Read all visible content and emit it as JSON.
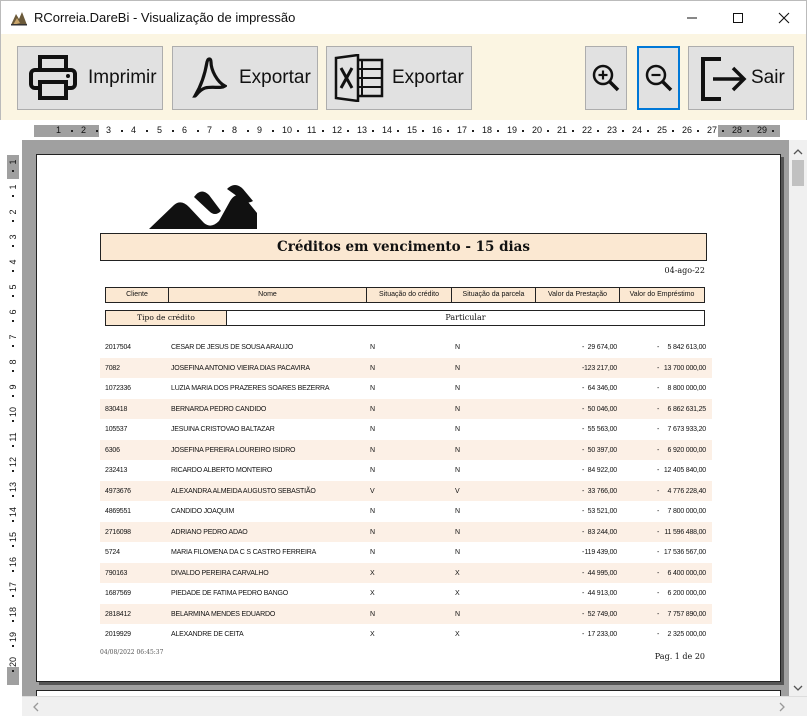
{
  "window": {
    "title": "RCorreia.DareBi - Visualização de impressão",
    "minimize_glyph": "—",
    "maximize_glyph": "☐",
    "close_glyph": "✕"
  },
  "toolbar": {
    "print_label": "Imprimir",
    "export_pdf_label": "Exportar",
    "export_excel_label": "Exportar",
    "exit_label": "Sair"
  },
  "ruler": {
    "h_marks": [
      "1",
      "1",
      "2",
      "3",
      "4",
      "5",
      "6",
      "7",
      "8",
      "9",
      "10",
      "11",
      "12",
      "13",
      "14",
      "15",
      "16",
      "17",
      "18",
      "19",
      "20",
      "21",
      "22",
      "23",
      "24",
      "25",
      "26",
      "27",
      "28",
      "29"
    ],
    "v_marks": [
      "1",
      "1",
      "2",
      "3",
      "4",
      "5",
      "6",
      "7",
      "8",
      "9",
      "10",
      "11",
      "12",
      "13",
      "14",
      "15",
      "16",
      "17",
      "18",
      "19",
      "20"
    ]
  },
  "report": {
    "title": "Créditos em vencimento - 15 dias",
    "date": "04-ago-22",
    "columns": [
      "Cliente",
      "Nome",
      "Situação do crédito",
      "Situação da parcela",
      "Valor da Prestação",
      "Valor do Empréstimo"
    ],
    "type_label": "Tipo de crédito",
    "type_value": "Particular",
    "rows": [
      {
        "client": "2017504",
        "name": "CESAR DE JESUS DE SOUSA ARAUJO",
        "sit": "N",
        "parc": "N",
        "prest": "29 674,00",
        "emp": "5 842 613,00"
      },
      {
        "client": "7082",
        "name": "JOSEFINA ANTONIO VIEIRA DIAS PACAVIRA",
        "sit": "N",
        "parc": "N",
        "prest": "123 217,00",
        "emp": "13 700 000,00"
      },
      {
        "client": "1072336",
        "name": "LUZIA MARIA DOS PRAZERES SOARES BEZERRA",
        "sit": "N",
        "parc": "N",
        "prest": "64 346,00",
        "emp": "8 800 000,00"
      },
      {
        "client": "830418",
        "name": "BERNARDA PEDRO CANDIDO",
        "sit": "N",
        "parc": "N",
        "prest": "50 046,00",
        "emp": "6 862 631,25"
      },
      {
        "client": "105537",
        "name": "JESUINA CRISTOVAO BALTAZAR",
        "sit": "N",
        "parc": "N",
        "prest": "55 563,00",
        "emp": "7 673 933,20"
      },
      {
        "client": "6306",
        "name": "JOSEFINA PEREIRA LOUREIRO ISIDRO",
        "sit": "N",
        "parc": "N",
        "prest": "50 397,00",
        "emp": "6 920 000,00"
      },
      {
        "client": "232413",
        "name": "RICARDO ALBERTO MONTEIRO",
        "sit": "N",
        "parc": "N",
        "prest": "84 922,00",
        "emp": "12 405 840,00"
      },
      {
        "client": "4973676",
        "name": "ALEXANDRA ALMEIDA AUGUSTO SEBASTIÃO",
        "sit": "V",
        "parc": "V",
        "prest": "33 766,00",
        "emp": "4 776 228,40"
      },
      {
        "client": "4869551",
        "name": "CANDIDO JOAQUIM",
        "sit": "N",
        "parc": "N",
        "prest": "53 521,00",
        "emp": "7 800 000,00"
      },
      {
        "client": "2716098",
        "name": "ADRIANO PEDRO ADAO",
        "sit": "N",
        "parc": "N",
        "prest": "83 244,00",
        "emp": "11 596 488,00"
      },
      {
        "client": "5724",
        "name": "MARIA FILOMENA DA C S CASTRO FERREIRA",
        "sit": "N",
        "parc": "N",
        "prest": "119 439,00",
        "emp": "17 536 567,00"
      },
      {
        "client": "790163",
        "name": "DIVALDO PEREIRA CARVALHO",
        "sit": "X",
        "parc": "X",
        "prest": "44 995,00",
        "emp": "6 400 000,00"
      },
      {
        "client": "1687569",
        "name": "PIEDADE DE FATIMA PEDRO BANGO",
        "sit": "X",
        "parc": "X",
        "prest": "44 913,00",
        "emp": "6 200 000,00"
      },
      {
        "client": "2818412",
        "name": "BELARMINA MENDES EDUARDO",
        "sit": "N",
        "parc": "N",
        "prest": "52 749,00",
        "emp": "7 757 890,00"
      },
      {
        "client": "2019929",
        "name": "ALEXANDRE DE CEITA",
        "sit": "X",
        "parc": "X",
        "prest": "17 233,00",
        "emp": "2 325 000,00"
      }
    ],
    "currency_dash": "-",
    "timestamp": "04/08/2022 06:45:37",
    "page_info": "Pag. 1 de 20"
  },
  "colors": {
    "toolbar_bg": "#fbf5e2",
    "header_fill": "#fbe8d2",
    "row_alt": "#fcf0e6",
    "canvas_bg": "#a0a0a0",
    "focus_border": "#0078d7"
  }
}
